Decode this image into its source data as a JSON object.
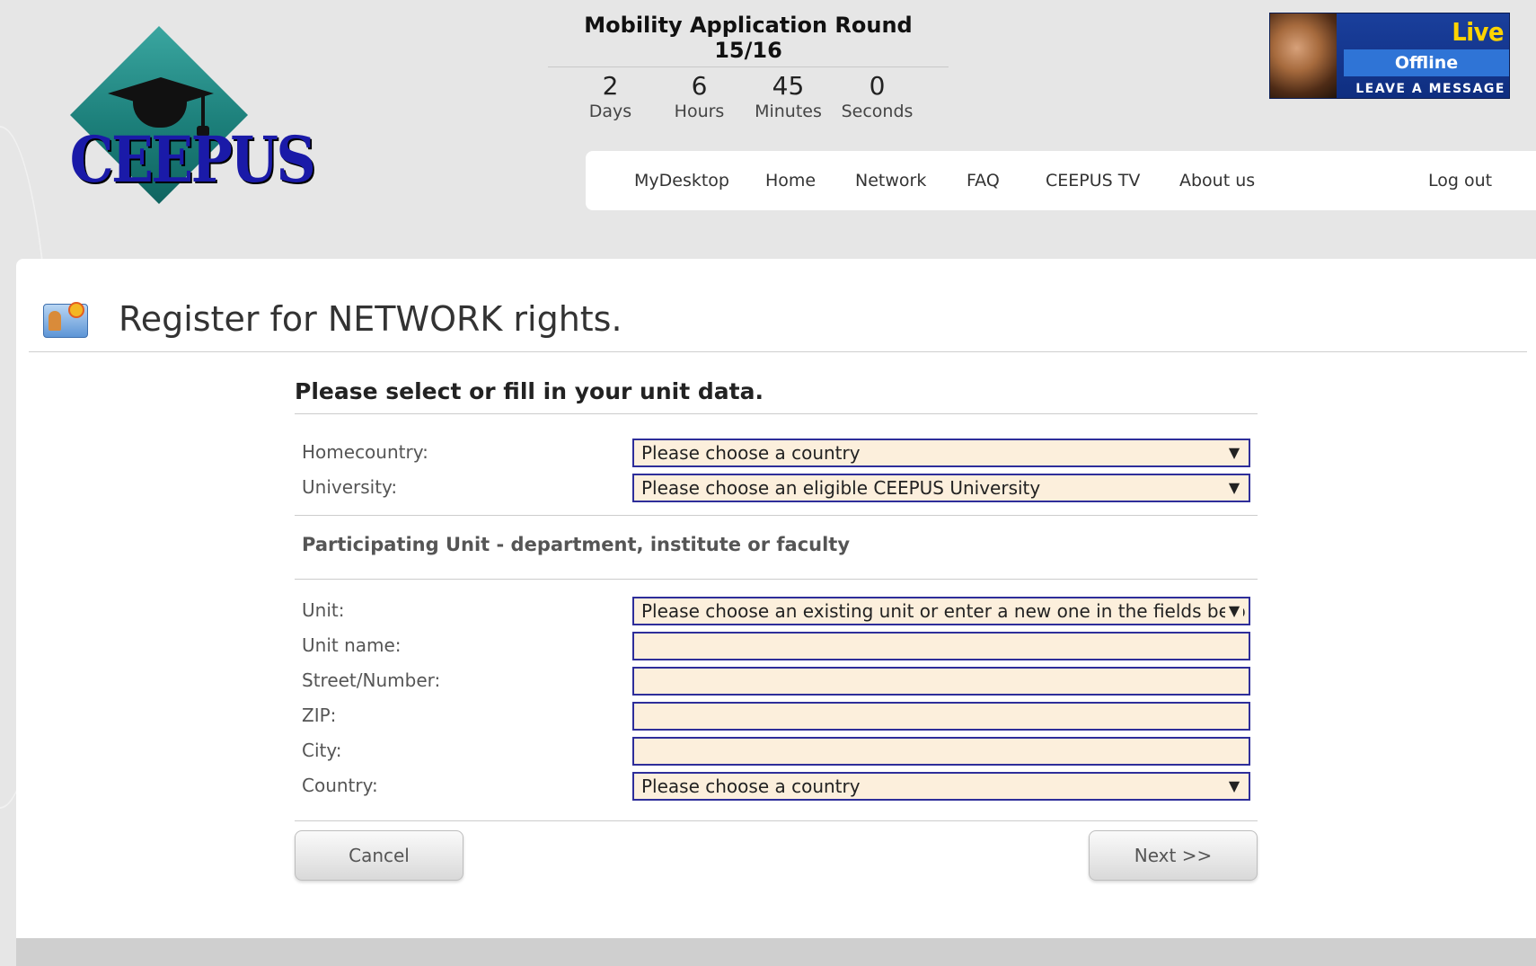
{
  "logo": {
    "text": "CEEPUS",
    "icon": "graduation-cap-icon"
  },
  "countdown": {
    "title": "Mobility Application Round 15/16",
    "items": [
      {
        "value": "2",
        "unit": "Days"
      },
      {
        "value": "6",
        "unit": "Hours"
      },
      {
        "value": "45",
        "unit": "Minutes"
      },
      {
        "value": "0",
        "unit": "Seconds"
      }
    ]
  },
  "live_support": {
    "headline": "Live Support!",
    "status": "Offline",
    "action": "LEAVE A MESSAGE <<<"
  },
  "nav": {
    "items": [
      "MyDesktop",
      "Home",
      "Network",
      "FAQ",
      "CEEPUS TV",
      "About us"
    ],
    "logout": "Log out"
  },
  "page": {
    "title": "Register for NETWORK rights.",
    "icon": "id-card-icon"
  },
  "form": {
    "heading": "Please select or fill in your unit data.",
    "homecountry": {
      "label": "Homecountry:",
      "value": "Please choose a country"
    },
    "university": {
      "label": "University:",
      "value": "Please choose an eligible CEEPUS University"
    },
    "unit_section": "Participating Unit - department, institute or faculty",
    "unit": {
      "label": "Unit:",
      "value": "Please choose an existing unit or enter a new one in the fields belo"
    },
    "unit_name": {
      "label": "Unit name:",
      "value": ""
    },
    "street": {
      "label": "Street/Number:",
      "value": ""
    },
    "zip": {
      "label": "ZIP:",
      "value": ""
    },
    "city": {
      "label": "City:",
      "value": ""
    },
    "country": {
      "label": "Country:",
      "value": "Please choose a country"
    },
    "cancel_label": "Cancel",
    "next_label": "Next >>"
  },
  "colors": {
    "field_bg": "#fcefdc",
    "field_border": "#2e2e9a",
    "page_bg": "#e6e6e6",
    "live_support_accent": "#ffd400"
  }
}
